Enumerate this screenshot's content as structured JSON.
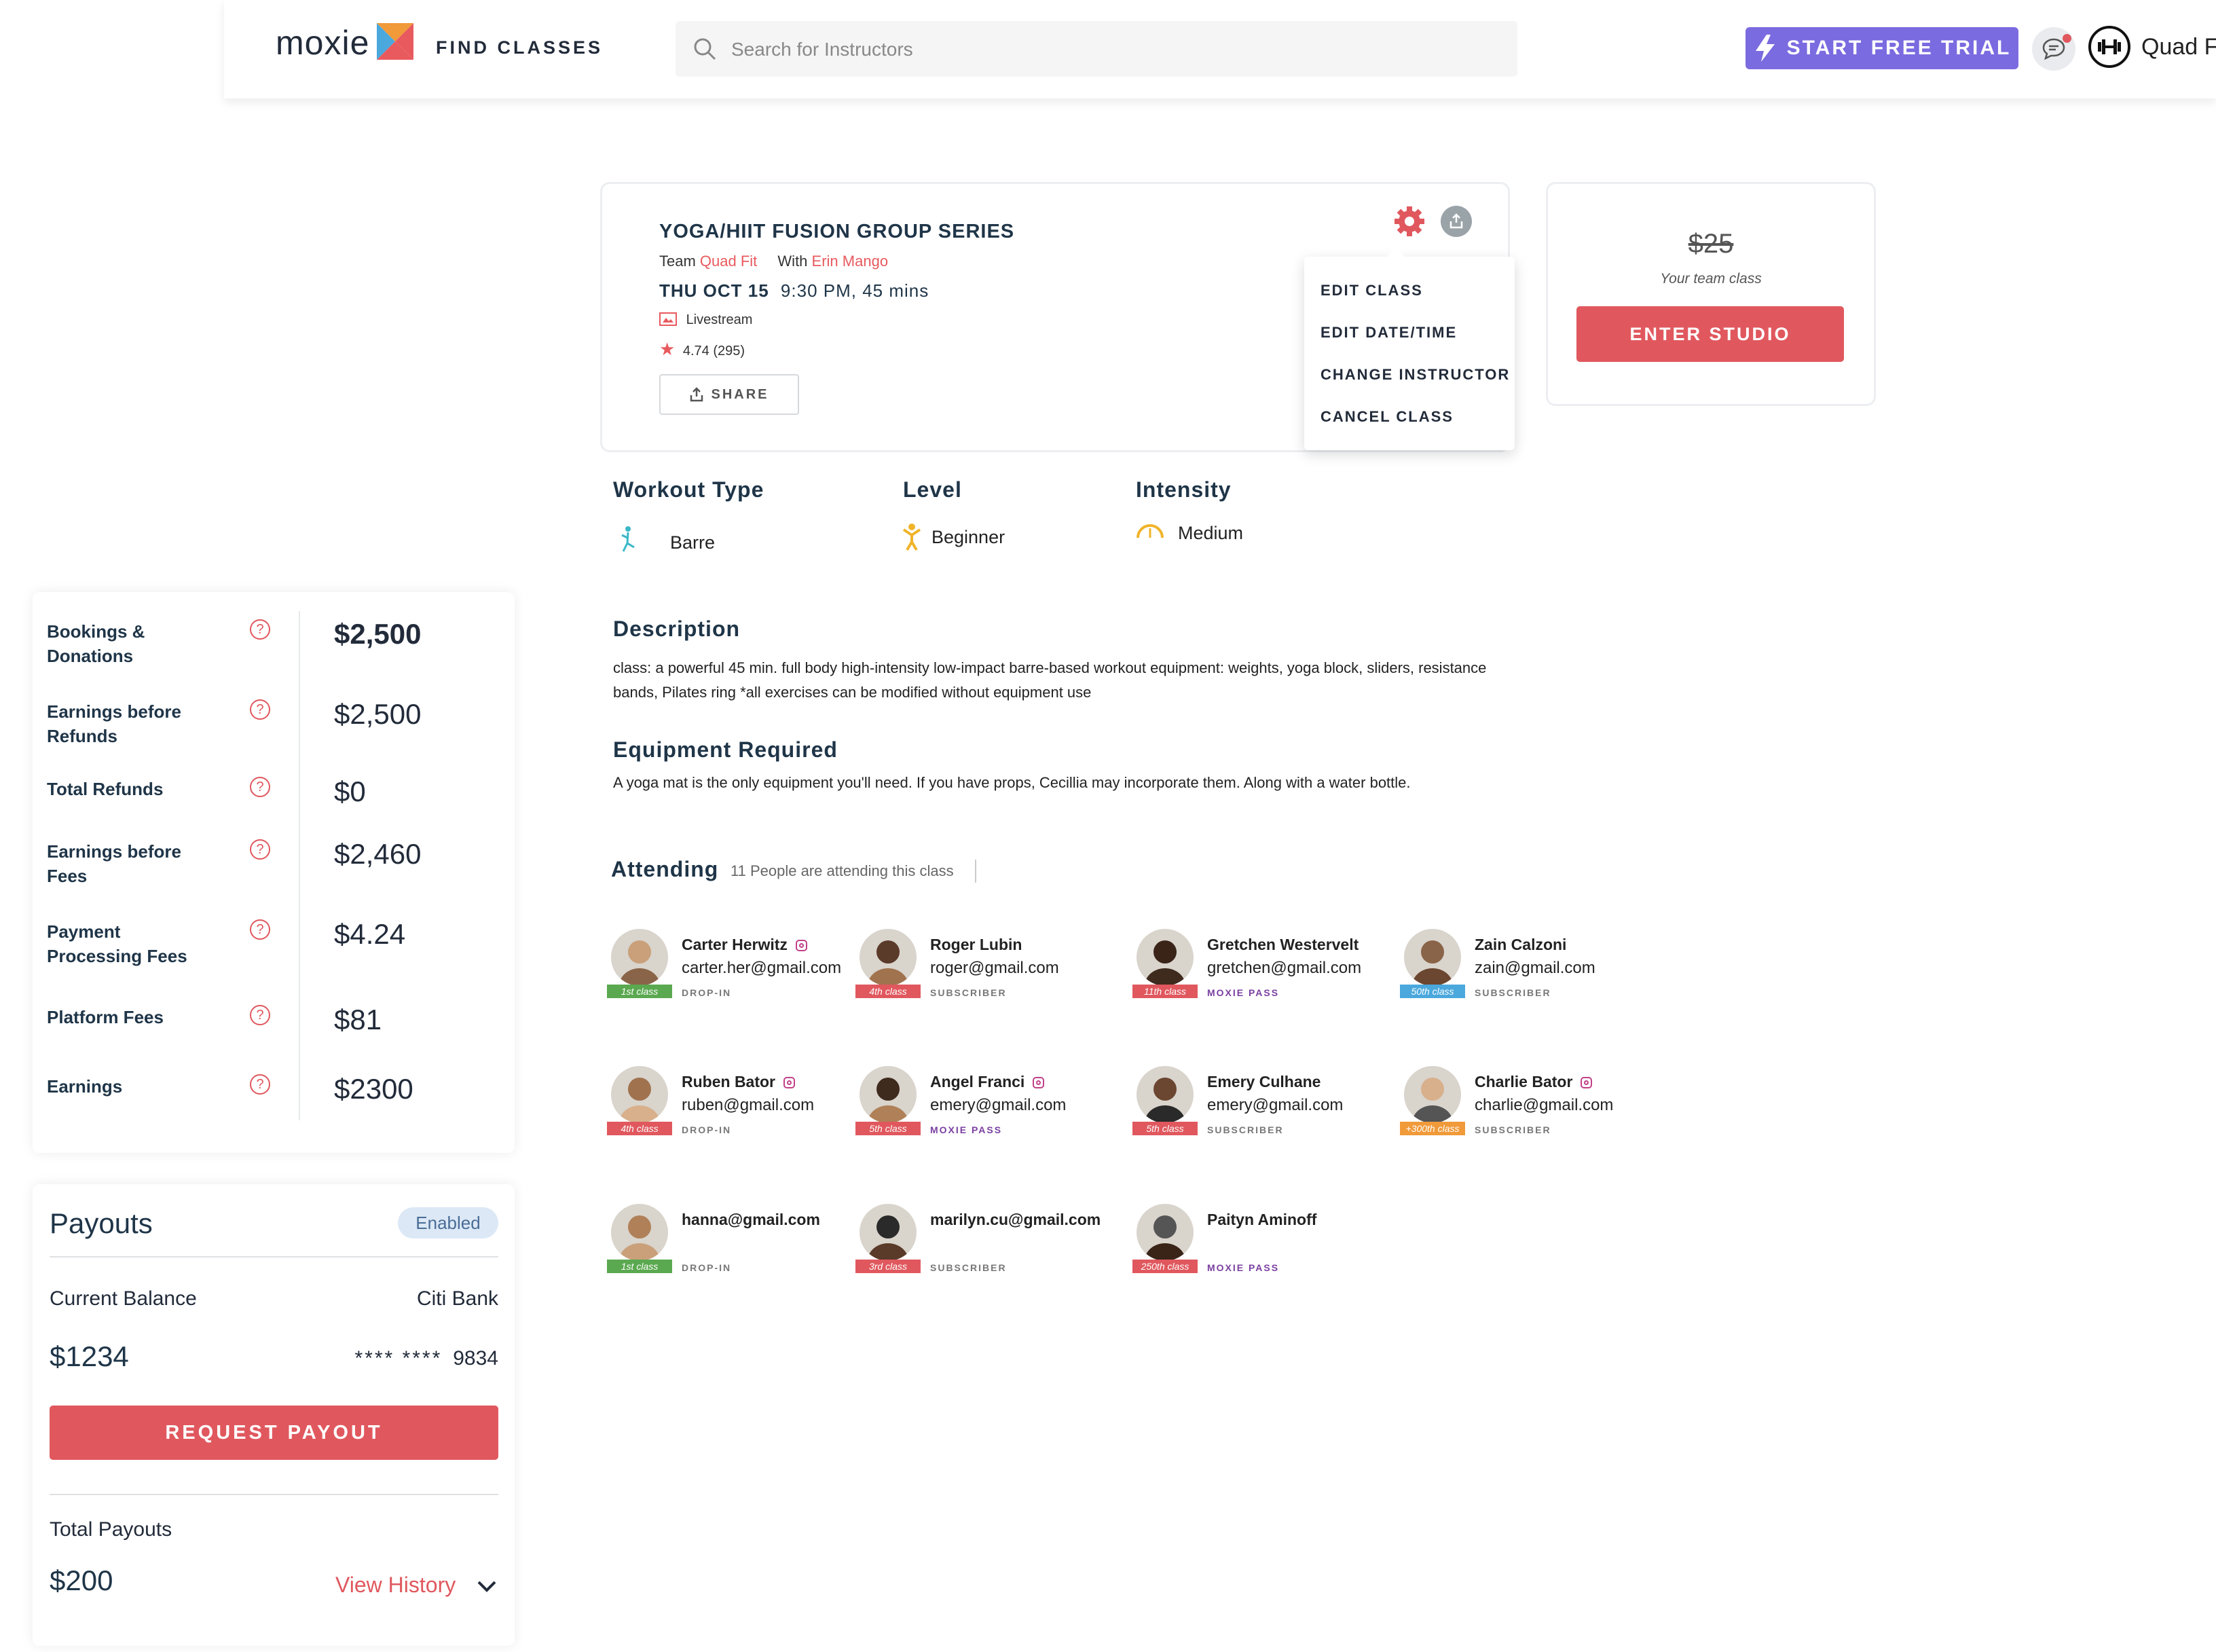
{
  "header": {
    "logo": "moxie",
    "find_classes": "FIND CLASSES",
    "search_placeholder": "Search for Instructors",
    "trial_label": "START FREE TRIAL",
    "user_name": "Quad F"
  },
  "class": {
    "title": "YOGA/HIIT FUSION GROUP SERIES",
    "team_label": "Team",
    "team_name": "Quad Fit",
    "with_label": "With",
    "instructor": "Erin Mango",
    "date": "THU OCT 15",
    "time": "9:30 PM, 45 mins",
    "stream": "Livestream",
    "rating": "4.74 (295)",
    "share_label": "SHARE"
  },
  "menu": {
    "items": [
      "EDIT CLASS",
      "EDIT DATE/TIME",
      "CHANGE INSTRUCTOR",
      "CANCEL CLASS"
    ]
  },
  "pricing": {
    "price": "$25",
    "subtitle": "Your team class",
    "enter_label": "ENTER STUDIO"
  },
  "attributes": {
    "workout_type_label": "Workout Type",
    "workout_type": "Barre",
    "level_label": "Level",
    "level": "Beginner",
    "intensity_label": "Intensity",
    "intensity": "Medium"
  },
  "description": {
    "heading": "Description",
    "text": "class: a powerful 45 min. full body high-intensity low-impact barre-based workout equipment: weights, yoga block, sliders, resistance bands, Pilates ring *all exercises can be modified without equipment use",
    "equipment_heading": "Equipment Required",
    "equipment_text": "A yoga mat is the only equipment you'll need. If you have props, Cecillia may incorporate them. Along with a water bottle."
  },
  "attending": {
    "heading": "Attending",
    "count_text": "11 People are attending this class",
    "people": [
      {
        "name": "Carter Herwitz",
        "email": "carter.her@gmail.com",
        "badge": "1st class",
        "type": "DROP-IN",
        "badge_color": "#5aa84f",
        "type_color": "#777777",
        "ig": true
      },
      {
        "name": "Roger Lubin",
        "email": "roger@gmail.com",
        "badge": "4th class",
        "type": "SUBSCRIBER",
        "badge_color": "#e0585e",
        "type_color": "#777777",
        "ig": false
      },
      {
        "name": "Gretchen Westervelt",
        "email": "gretchen@gmail.com",
        "badge": "11th class",
        "type": "MOXIE PASS",
        "badge_color": "#e0585e",
        "type_color": "#7a3fa0",
        "ig": false
      },
      {
        "name": "Zain Calzoni",
        "email": "zain@gmail.com",
        "badge": "50th class",
        "type": "SUBSCRIBER",
        "badge_color": "#4aa8dd",
        "type_color": "#777777",
        "ig": false
      },
      {
        "name": "Ruben Bator",
        "email": "ruben@gmail.com",
        "badge": "4th class",
        "type": "DROP-IN",
        "badge_color": "#e0585e",
        "type_color": "#777777",
        "ig": true
      },
      {
        "name": "Angel Franci",
        "email": "emery@gmail.com",
        "badge": "5th class",
        "type": "MOXIE PASS",
        "badge_color": "#e0585e",
        "type_color": "#7a3fa0",
        "ig": true
      },
      {
        "name": "Emery Culhane",
        "email": "emery@gmail.com",
        "badge": "5th class",
        "type": "SUBSCRIBER",
        "badge_color": "#e0585e",
        "type_color": "#777777",
        "ig": false
      },
      {
        "name": "Charlie Bator",
        "email": "charlie@gmail.com",
        "badge": "+300th class",
        "type": "SUBSCRIBER",
        "badge_color": "#f09a3a",
        "type_color": "#777777",
        "ig": true
      },
      {
        "name": "",
        "email": "hanna@gmail.com",
        "badge": "1st class",
        "type": "DROP-IN",
        "badge_color": "#5aa84f",
        "type_color": "#777777",
        "ig": false
      },
      {
        "name": "",
        "email": "marilyn.cu@gmail.com",
        "badge": "3rd class",
        "type": "SUBSCRIBER",
        "badge_color": "#e0585e",
        "type_color": "#777777",
        "ig": false
      },
      {
        "name": "Paityn Aminoff",
        "email": "",
        "badge": "250th class",
        "type": "MOXIE PASS",
        "badge_color": "#e0585e",
        "type_color": "#7a3fa0",
        "ig": false
      }
    ]
  },
  "earnings": {
    "rows": [
      {
        "label": "Bookings & Donations",
        "value": "$2,500"
      },
      {
        "label": "Earnings before Refunds",
        "value": "$2,500"
      },
      {
        "label": "Total Refunds",
        "value": "$0"
      },
      {
        "label": "Earnings before Fees",
        "value": "$2,460"
      },
      {
        "label": "Payment Processing Fees",
        "value": "$4.24"
      },
      {
        "label": "Platform Fees",
        "value": "$81"
      },
      {
        "label": "Earnings",
        "value": "$2300"
      }
    ]
  },
  "payouts": {
    "title": "Payouts",
    "status": "Enabled",
    "balance_label": "Current Balance",
    "bank": "Citi Bank",
    "balance": "$1234",
    "account_mask": "**** ****",
    "account_last4": "9834",
    "request_label": "REQUEST PAYOUT",
    "total_label": "Total Payouts",
    "total": "$200",
    "history_label": "View History"
  },
  "colors": {
    "accent": "#e0585e",
    "trial": "#7a6be0",
    "navy": "#1f3548"
  }
}
